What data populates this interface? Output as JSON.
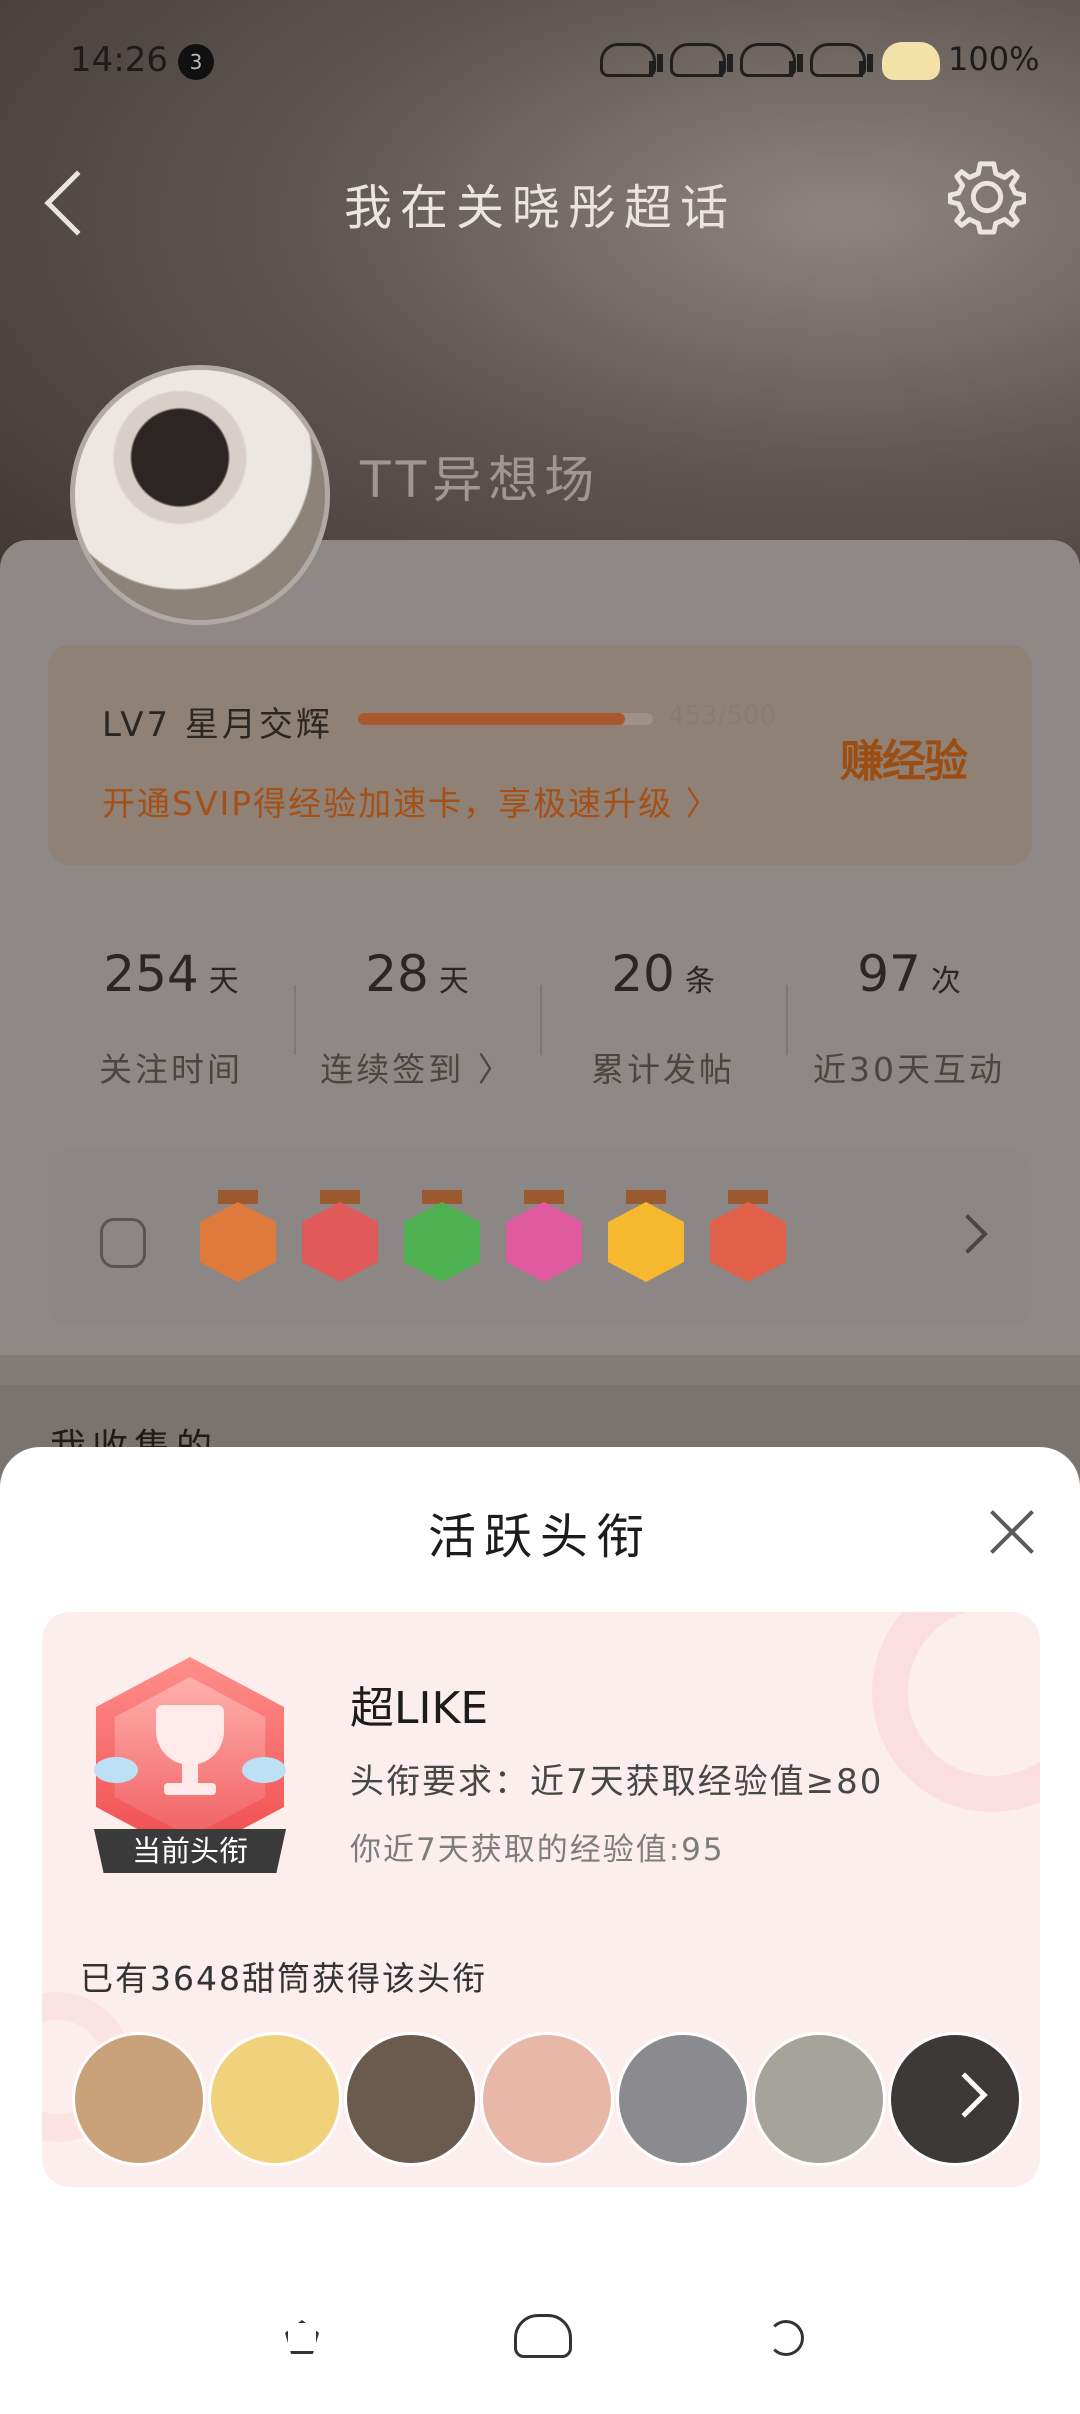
{
  "status_bar": {
    "time": "14:26",
    "notification_count": "3",
    "battery": "100%"
  },
  "nav": {
    "title": "我在关晓彤超话"
  },
  "profile": {
    "name": "TT异想场"
  },
  "level": {
    "name": "LV7 星月交辉",
    "progress_text": "453/500",
    "progress_fraction": 0.906,
    "promo": "开通SVIP得经验加速卡，享极速升级 〉",
    "earn_label": "赚经验"
  },
  "stats": [
    {
      "value": "254",
      "unit": "天",
      "label": "关注时间"
    },
    {
      "value": "28",
      "unit": "天",
      "label": "连续签到 〉"
    },
    {
      "value": "20",
      "unit": "条",
      "label": "累计发帖"
    },
    {
      "value": "97",
      "unit": "次",
      "label": "近30天互动"
    }
  ],
  "medals": [
    {
      "name": "lv7-medal-icon",
      "color": "#e07a3c"
    },
    {
      "name": "trophy-medal-icon",
      "color": "#e05a5a"
    },
    {
      "name": "hand-medal-icon",
      "color": "#4caf50"
    },
    {
      "name": "hat-medal-icon",
      "color": "#e05aa0"
    },
    {
      "name": "laugh-medal-icon",
      "color": "#f5b82e"
    },
    {
      "name": "rock-hand-medal-icon",
      "color": "#e0604a"
    }
  ],
  "collected_label": "我收集的",
  "sheet": {
    "title": "活跃头衔",
    "badge": {
      "tag": "当前头衔",
      "color": "#ef4b4d"
    },
    "title_name": "超LIKE",
    "requirement": "头衔要求：近7天获取经验值≥80",
    "your_xp": "你近7天获取的经验值:95",
    "holders_count": "已有3648甜筒获得该头衔",
    "holder_avatar_colors": [
      "#c9a27a",
      "#f0d27c",
      "#6b5b4f",
      "#e7b7a7",
      "#8b8a8f",
      "#a6a39a",
      "#3d3936"
    ]
  }
}
